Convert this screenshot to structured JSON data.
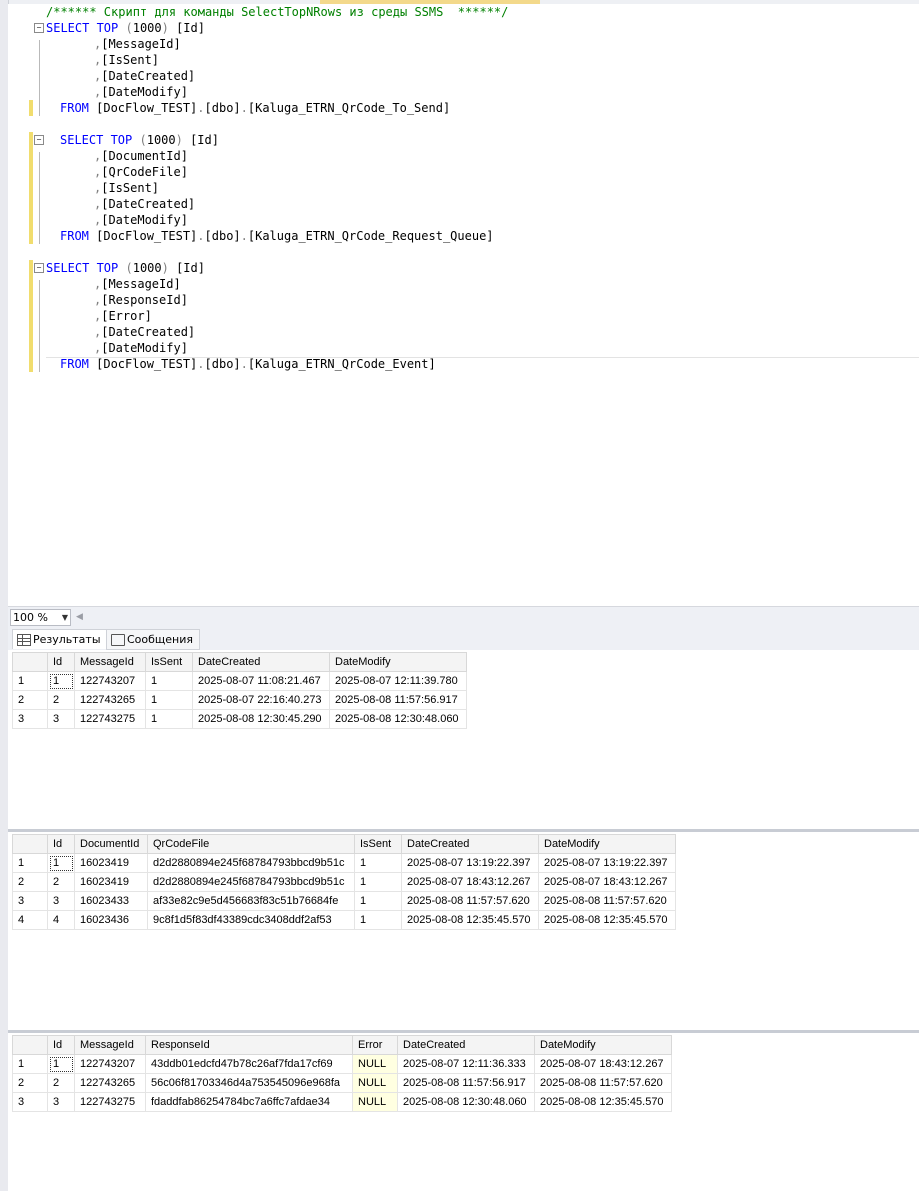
{
  "editor": {
    "lines": [
      {
        "fold": null,
        "indent": 0,
        "tokens": [
          {
            "c": "cm",
            "t": "/****** Скрипт для команды SelectTopNRows из среды SSMS  ******/"
          }
        ]
      },
      {
        "fold": "-",
        "indent": 0,
        "tokens": [
          {
            "c": "kw",
            "t": "SELECT TOP "
          },
          {
            "c": "gr",
            "t": "("
          },
          {
            "c": "",
            "t": "1000"
          },
          {
            "c": "gr",
            "t": ")"
          },
          {
            "c": "",
            "t": " [Id]"
          }
        ]
      },
      {
        "fold": null,
        "indent": 1,
        "tokens": [
          {
            "c": "gr",
            "t": ","
          },
          {
            "c": "",
            "t": "[MessageId]"
          }
        ]
      },
      {
        "fold": null,
        "indent": 1,
        "tokens": [
          {
            "c": "gr",
            "t": ","
          },
          {
            "c": "",
            "t": "[IsSent]"
          }
        ]
      },
      {
        "fold": null,
        "indent": 1,
        "tokens": [
          {
            "c": "gr",
            "t": ","
          },
          {
            "c": "",
            "t": "[DateCreated]"
          }
        ]
      },
      {
        "fold": null,
        "indent": 1,
        "tokens": [
          {
            "c": "gr",
            "t": ","
          },
          {
            "c": "",
            "t": "[DateModify]"
          }
        ]
      },
      {
        "fold": null,
        "indent": 2,
        "tokens": [
          {
            "c": "kw",
            "t": "FROM "
          },
          {
            "c": "",
            "t": "[DocFlow_TEST]"
          },
          {
            "c": "gr",
            "t": "."
          },
          {
            "c": "",
            "t": "[dbo]"
          },
          {
            "c": "gr",
            "t": "."
          },
          {
            "c": "",
            "t": "[Kaluga_ETRN_QrCode_To_Send]"
          }
        ]
      },
      {
        "fold": null,
        "indent": 0,
        "tokens": []
      },
      {
        "fold": "-",
        "indent": 2,
        "tokens": [
          {
            "c": "kw",
            "t": "SELECT TOP "
          },
          {
            "c": "gr",
            "t": "("
          },
          {
            "c": "",
            "t": "1000"
          },
          {
            "c": "gr",
            "t": ")"
          },
          {
            "c": "",
            "t": " [Id]"
          }
        ]
      },
      {
        "fold": null,
        "indent": 1,
        "tokens": [
          {
            "c": "gr",
            "t": ","
          },
          {
            "c": "",
            "t": "[DocumentId]"
          }
        ]
      },
      {
        "fold": null,
        "indent": 1,
        "tokens": [
          {
            "c": "gr",
            "t": ","
          },
          {
            "c": "",
            "t": "[QrCodeFile]"
          }
        ]
      },
      {
        "fold": null,
        "indent": 1,
        "tokens": [
          {
            "c": "gr",
            "t": ","
          },
          {
            "c": "",
            "t": "[IsSent]"
          }
        ]
      },
      {
        "fold": null,
        "indent": 1,
        "tokens": [
          {
            "c": "gr",
            "t": ","
          },
          {
            "c": "",
            "t": "[DateCreated]"
          }
        ]
      },
      {
        "fold": null,
        "indent": 1,
        "tokens": [
          {
            "c": "gr",
            "t": ","
          },
          {
            "c": "",
            "t": "[DateModify]"
          }
        ]
      },
      {
        "fold": null,
        "indent": 2,
        "tokens": [
          {
            "c": "kw",
            "t": "FROM "
          },
          {
            "c": "",
            "t": "[DocFlow_TEST]"
          },
          {
            "c": "gr",
            "t": "."
          },
          {
            "c": "",
            "t": "[dbo]"
          },
          {
            "c": "gr",
            "t": "."
          },
          {
            "c": "",
            "t": "[Kaluga_ETRN_QrCode_Request_Queue]"
          }
        ]
      },
      {
        "fold": null,
        "indent": 0,
        "tokens": []
      },
      {
        "fold": "-",
        "indent": 0,
        "tokens": [
          {
            "c": "kw",
            "t": "SELECT TOP "
          },
          {
            "c": "gr",
            "t": "("
          },
          {
            "c": "",
            "t": "1000"
          },
          {
            "c": "gr",
            "t": ")"
          },
          {
            "c": "",
            "t": " [Id]"
          }
        ]
      },
      {
        "fold": null,
        "indent": 1,
        "tokens": [
          {
            "c": "gr",
            "t": ","
          },
          {
            "c": "",
            "t": "[MessageId]"
          }
        ]
      },
      {
        "fold": null,
        "indent": 1,
        "tokens": [
          {
            "c": "gr",
            "t": ","
          },
          {
            "c": "",
            "t": "[ResponseId]"
          }
        ]
      },
      {
        "fold": null,
        "indent": 1,
        "tokens": [
          {
            "c": "gr",
            "t": ","
          },
          {
            "c": "",
            "t": "[Error]"
          }
        ]
      },
      {
        "fold": null,
        "indent": 1,
        "tokens": [
          {
            "c": "gr",
            "t": ","
          },
          {
            "c": "",
            "t": "[DateCreated]"
          }
        ]
      },
      {
        "fold": null,
        "indent": 1,
        "tokens": [
          {
            "c": "gr",
            "t": ","
          },
          {
            "c": "",
            "t": "[DateModify]"
          }
        ]
      },
      {
        "fold": null,
        "indent": 2,
        "tokens": [
          {
            "c": "kw",
            "t": "FROM "
          },
          {
            "c": "",
            "t": "[DocFlow_TEST]"
          },
          {
            "c": "gr",
            "t": "."
          },
          {
            "c": "",
            "t": "[dbo]"
          },
          {
            "c": "gr",
            "t": "."
          },
          {
            "c": "",
            "t": "[Kaluga_ETRN_QrCode_Event]"
          }
        ]
      }
    ]
  },
  "zoom": {
    "value": "100 %"
  },
  "tabs": {
    "results": "Результаты",
    "messages": "Сообщения"
  },
  "grids": [
    {
      "columns": [
        "",
        "Id",
        "MessageId",
        "IsSent",
        "DateCreated",
        "DateModify"
      ],
      "rows": [
        [
          "1",
          "1",
          "122743207",
          "1",
          "2025-08-07 11:08:21.467",
          "2025-08-07 12:11:39.780"
        ],
        [
          "2",
          "2",
          "122743265",
          "1",
          "2025-08-07 22:16:40.273",
          "2025-08-08 11:57:56.917"
        ],
        [
          "3",
          "3",
          "122743275",
          "1",
          "2025-08-08 12:30:45.290",
          "2025-08-08 12:30:48.060"
        ]
      ]
    },
    {
      "columns": [
        "",
        "Id",
        "DocumentId",
        "QrCodeFile",
        "IsSent",
        "DateCreated",
        "DateModify"
      ],
      "rows": [
        [
          "1",
          "1",
          "16023419",
          "d2d2880894e245f68784793bbcd9b51c",
          "1",
          "2025-08-07 13:19:22.397",
          "2025-08-07 13:19:22.397"
        ],
        [
          "2",
          "2",
          "16023419",
          "d2d2880894e245f68784793bbcd9b51c",
          "1",
          "2025-08-07 18:43:12.267",
          "2025-08-07 18:43:12.267"
        ],
        [
          "3",
          "3",
          "16023433",
          "af33e82c9e5d456683f83c51b76684fe",
          "1",
          "2025-08-08 11:57:57.620",
          "2025-08-08 11:57:57.620"
        ],
        [
          "4",
          "4",
          "16023436",
          "9c8f1d5f83df43389cdc3408ddf2af53",
          "1",
          "2025-08-08 12:35:45.570",
          "2025-08-08 12:35:45.570"
        ]
      ]
    },
    {
      "columns": [
        "",
        "Id",
        "MessageId",
        "ResponseId",
        "Error",
        "DateCreated",
        "DateModify"
      ],
      "rows": [
        [
          "1",
          "1",
          "122743207",
          "43ddb01edcfd47b78c26af7fda17cf69",
          "NULL",
          "2025-08-07 12:11:36.333",
          "2025-08-07 18:43:12.267"
        ],
        [
          "2",
          "2",
          "122743265",
          "56c06f81703346d4a753545096e968fa",
          "NULL",
          "2025-08-08 11:57:56.917",
          "2025-08-08 11:57:57.620"
        ],
        [
          "3",
          "3",
          "122743275",
          "fdaddfab86254784bc7a6ffc7afdae34",
          "NULL",
          "2025-08-08 12:30:48.060",
          "2025-08-08 12:35:45.570"
        ]
      ]
    }
  ]
}
